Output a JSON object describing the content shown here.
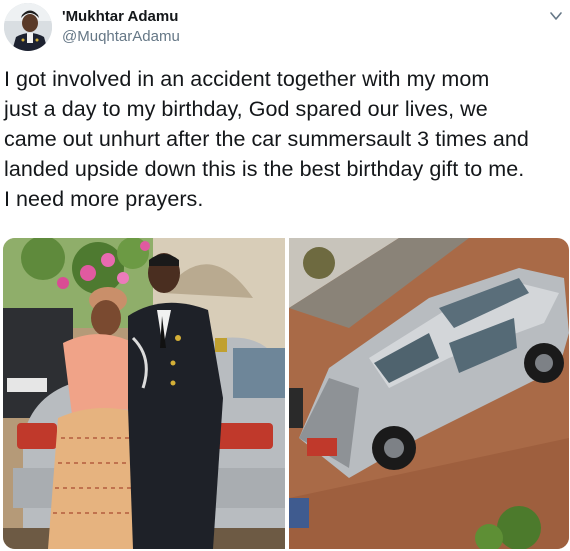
{
  "user": {
    "display_name": "'Mukhtar Adamu",
    "handle": "@MuqhtarAdamu"
  },
  "tweet": {
    "text": "I got involved in an accident together with my mom\njust a day to my birthday, God spared our lives, we\ncame out unhurt after the car summersault 3 times and\nlanded upside down this is the best birthday gift to me.\nI need more prayers."
  },
  "media": {
    "photos": [
      {
        "icon": "photo-officer-and-mother-by-car"
      },
      {
        "icon": "photo-damaged-silver-car"
      }
    ]
  },
  "icons": {
    "caret": "chevron-down-icon"
  },
  "colors": {
    "name_text": "#14171a",
    "handle_text": "#657786",
    "car_silver": "#b8bcc0"
  }
}
